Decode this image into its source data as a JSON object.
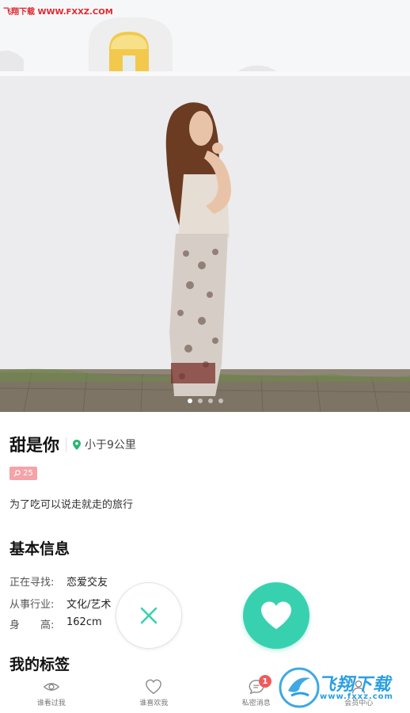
{
  "watermark_top": "飞翔下载 WWW.FXXZ.COM",
  "profile": {
    "name": "甜是你",
    "distance": "小于9公里",
    "age_badge": "25",
    "bio": "为了吃可以说走就走的旅行"
  },
  "basic_info": {
    "title": "基本信息",
    "rows": [
      {
        "label": "正在寻找:",
        "value": "恋爱交友"
      },
      {
        "label": "从事行业:",
        "value": "文化/艺术"
      },
      {
        "label": "身　　高:",
        "value": "162cm"
      }
    ]
  },
  "tags": {
    "title": "我的标签"
  },
  "photo": {
    "page_count": 4,
    "active_page": 1
  },
  "actions": {
    "dislike_icon": "close-icon",
    "like_icon": "heart-icon"
  },
  "tabbar": {
    "tabs": [
      {
        "label": "谁看过我",
        "icon": "eye-icon"
      },
      {
        "label": "谁喜欢我",
        "icon": "heart-outline-icon"
      },
      {
        "label": "私密消息",
        "icon": "chat-icon",
        "badge": "1"
      },
      {
        "label": "会员中心",
        "icon": "user-icon"
      }
    ]
  },
  "watermark_bottom": {
    "text": "飞翔下载",
    "url": "www.fxxz.com"
  },
  "colors": {
    "accent": "#38d1b0",
    "badge_pink": "#f5a3a8",
    "pin_green": "#2bb673",
    "unread_red": "#f05a5a"
  }
}
